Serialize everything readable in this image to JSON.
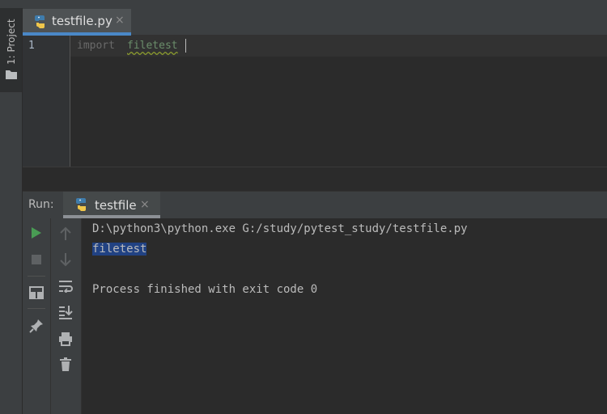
{
  "sidebar": {
    "project_tab_label": "1: Project"
  },
  "editor": {
    "tab": {
      "filename": "testfile.py",
      "close_glyph": "×"
    },
    "line_number": "1",
    "code": {
      "keyword": "import",
      "module": "filetest"
    }
  },
  "run_panel": {
    "label": "Run:",
    "tab": {
      "title": "testfile",
      "close_glyph": "×"
    },
    "console": {
      "command": "D:\\python3\\python.exe G:/study/pytest_study/testfile.py",
      "output": "filetest",
      "exit_message": "Process finished with exit code 0"
    }
  },
  "icons": {
    "run": "play-icon",
    "stop": "stop-icon",
    "layout": "layout-icon",
    "pin": "pin-icon",
    "up": "arrow-up-icon",
    "down": "arrow-down-icon",
    "soft_wrap": "soft-wrap-icon",
    "scroll_to_end": "scroll-to-end-icon",
    "print": "print-icon",
    "trash": "trash-icon"
  },
  "colors": {
    "accent": "#4a88c7",
    "run_green": "#499c54",
    "selection": "#214283"
  }
}
